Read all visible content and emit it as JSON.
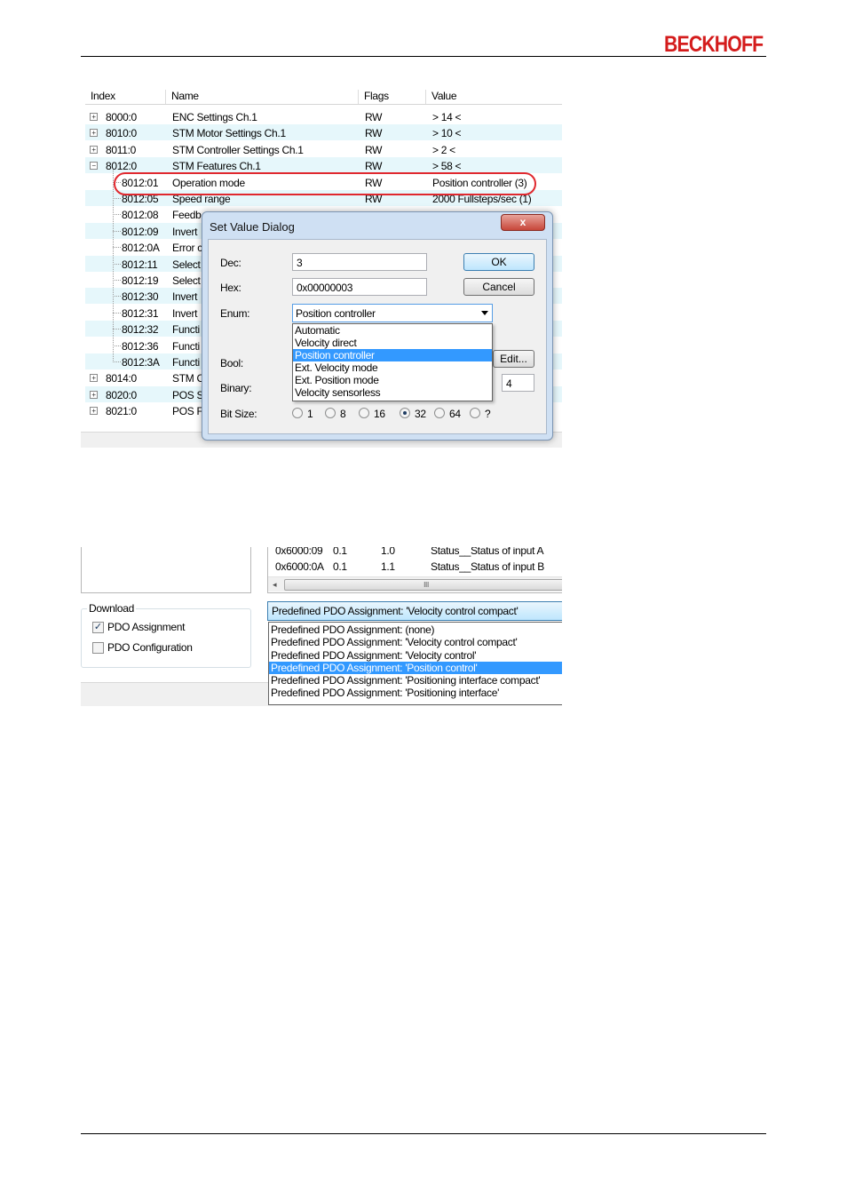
{
  "header": {
    "logo": "BECKHOFF"
  },
  "shot1": {
    "columns": [
      "Index",
      "Name",
      "Flags",
      "Value"
    ],
    "rows": [
      {
        "index": "8000:0",
        "name": "ENC Settings Ch.1",
        "flags": "RW",
        "value": "> 14 <",
        "expander": "+"
      },
      {
        "index": "8010:0",
        "name": "STM Motor Settings Ch.1",
        "flags": "RW",
        "value": "> 10 <",
        "expander": "+"
      },
      {
        "index": "8011:0",
        "name": "STM Controller Settings Ch.1",
        "flags": "RW",
        "value": "> 2 <",
        "expander": "+"
      },
      {
        "index": "8012:0",
        "name": "STM Features Ch.1",
        "flags": "RW",
        "value": "> 58 <",
        "expander": "−"
      },
      {
        "index": "8012:01",
        "name": "Operation mode",
        "flags": "RW",
        "value": "Position controller (3)"
      },
      {
        "index": "8012:05",
        "name": "Speed range",
        "flags": "RW",
        "value": "2000 Fullsteps/sec (1)"
      },
      {
        "index": "8012:08",
        "name": "Feedb",
        "flags": "",
        "value": ""
      },
      {
        "index": "8012:09",
        "name": "Invert",
        "flags": "",
        "value": ""
      },
      {
        "index": "8012:0A",
        "name": "Error c",
        "flags": "",
        "value": ""
      },
      {
        "index": "8012:11",
        "name": "Select",
        "flags": "",
        "value": ""
      },
      {
        "index": "8012:19",
        "name": "Select",
        "flags": "",
        "value": ""
      },
      {
        "index": "8012:30",
        "name": "Invert",
        "flags": "",
        "value": ""
      },
      {
        "index": "8012:31",
        "name": "Invert",
        "flags": "",
        "value": ""
      },
      {
        "index": "8012:32",
        "name": "Functi",
        "flags": "",
        "value": ""
      },
      {
        "index": "8012:36",
        "name": "Functi",
        "flags": "",
        "value": ""
      },
      {
        "index": "8012:3A",
        "name": "Functi",
        "flags": "",
        "value": ""
      },
      {
        "index": "8014:0",
        "name": "STM C",
        "flags": "",
        "value": "",
        "expander": "+"
      },
      {
        "index": "8020:0",
        "name": "POS S",
        "flags": "",
        "value": "",
        "expander": "+"
      },
      {
        "index": "8021:0",
        "name": "POS F",
        "flags": "",
        "value": "",
        "expander": "+"
      }
    ],
    "dialog": {
      "title": "Set Value Dialog",
      "close": "x",
      "dec_label": "Dec:",
      "dec_value": "3",
      "hex_label": "Hex:",
      "hex_value": "0x00000003",
      "enum_label": "Enum:",
      "enum_value": "Position controller",
      "ok": "OK",
      "cancel": "Cancel",
      "bool_label": "Bool:",
      "edit": "Edit...",
      "binary_label": "Binary:",
      "binary_size": "4",
      "bitsize_label": "Bit Size:",
      "bitsizes": [
        "1",
        "8",
        "16",
        "32",
        "64",
        "?"
      ],
      "bitsize_selected": "32",
      "enum_options": [
        "Automatic",
        "Velocity direct",
        "Position controller",
        "Ext. Velocity mode",
        "Ext. Position mode",
        "Velocity sensorless"
      ],
      "enum_selected_index": 2
    }
  },
  "shot2": {
    "rows": [
      {
        "index": "0x6000:09",
        "size": "0.1",
        "offs": "1.0",
        "name": "Status__Status of input A"
      },
      {
        "index": "0x6000:0A",
        "size": "0.1",
        "offs": "1.1",
        "name": "Status__Status of input B"
      }
    ],
    "scroll_grip": "III",
    "download_title": "Download",
    "pdo_assignment_label": "PDO Assignment",
    "pdo_assignment_checked": true,
    "pdo_configuration_label": "PDO Configuration",
    "pdo_configuration_checked": false,
    "combo_value": "Predefined PDO Assignment: 'Velocity control compact'",
    "options": [
      "Predefined PDO Assignment: (none)",
      "Predefined PDO Assignment: 'Velocity control compact'",
      "Predefined PDO Assignment: 'Velocity control'",
      "Predefined PDO Assignment: 'Position control'",
      "Predefined PDO Assignment: 'Positioning interface compact'",
      "Predefined PDO Assignment: 'Positioning interface'"
    ],
    "selected_index": 3
  }
}
